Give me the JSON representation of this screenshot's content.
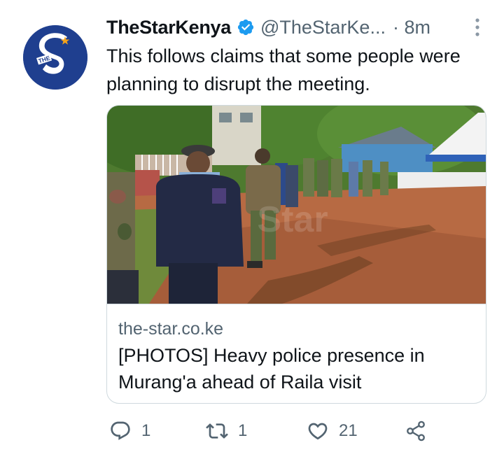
{
  "tweet": {
    "display_name": "TheStarKenya",
    "handle": "@TheStarKe...",
    "time": "· 8m",
    "text": "This follows claims that some people were planning to disrupt the meeting.",
    "avatar": {
      "letter": "S",
      "badge": "THE",
      "colors": {
        "bg": "#1f3f8f",
        "star": "#f4a31b"
      }
    }
  },
  "card": {
    "domain": "the-star.co.ke",
    "title": "[PHOTOS] Heavy police presence in Murang'a ahead of Raila visit",
    "image_icon": "photo-police-officers-walking",
    "watermark": "Star"
  },
  "actions": {
    "reply_count": "1",
    "retweet_count": "1",
    "like_count": "21"
  },
  "icons": {
    "verified": "verified-badge-icon",
    "more": "more-vertical-icon",
    "reply": "reply-icon",
    "retweet": "retweet-icon",
    "like": "heart-icon",
    "share": "share-icon"
  },
  "colors": {
    "verified": "#1d9bf0",
    "secondary_text": "#536471",
    "border": "#cfd9de"
  }
}
